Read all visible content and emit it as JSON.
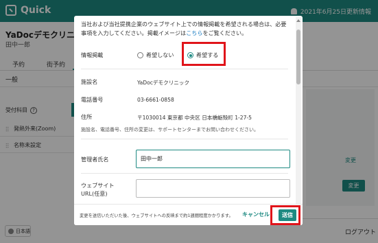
{
  "app": {
    "logo_text": "Quick",
    "update_info": "2021年6月25日更新情報",
    "clinic_name": "YaDocデモクリニック",
    "user_name": "田中一郎",
    "tabs": [
      "予約",
      "街予約"
    ],
    "general_label": "一般",
    "section_label": "受付科目",
    "items": [
      "発熱外来(Zoom)",
      "名称未設定"
    ],
    "link_change": "変更",
    "button_change": "変更",
    "logout": "ログアウト",
    "language": "日本語"
  },
  "modal": {
    "intro_text": "当社および当社提携企業のウェブサイト上での情報掲載を希望される場合は、必要事項を入力してください。掲載イメージは",
    "intro_link": "こちら",
    "intro_tail": "をご覧ください。",
    "info_label": "情報掲載",
    "option_no": "希望しない",
    "option_yes": "希望する",
    "selected": "希望する",
    "facility_label": "施設名",
    "facility_value": "YaDocデモクリニック",
    "phone_label": "電話番号",
    "phone_value": "03-6661-0858",
    "address_label": "住所",
    "address_value": "〒1030014 東京都 中央区 日本橋蛎殻町 1-27-5",
    "change_note": "施設名、電話番号、住所の変更は、サポートセンターまでお問い合わせください。",
    "manager_label": "管理者氏名",
    "manager_value": "田中一郎",
    "website_label_1": "ウェブサイト",
    "website_label_2": "URL(任意)",
    "website_value": "",
    "footer_note": "変更を送信いただいた後、ウェブサイトへの反映まで約1週間程度かかります。",
    "cancel_label": "キャンセル",
    "send_label": "送信"
  },
  "colors": {
    "brand": "#1e8a82",
    "highlight": "#e0141a",
    "link": "#1e7fc4"
  }
}
